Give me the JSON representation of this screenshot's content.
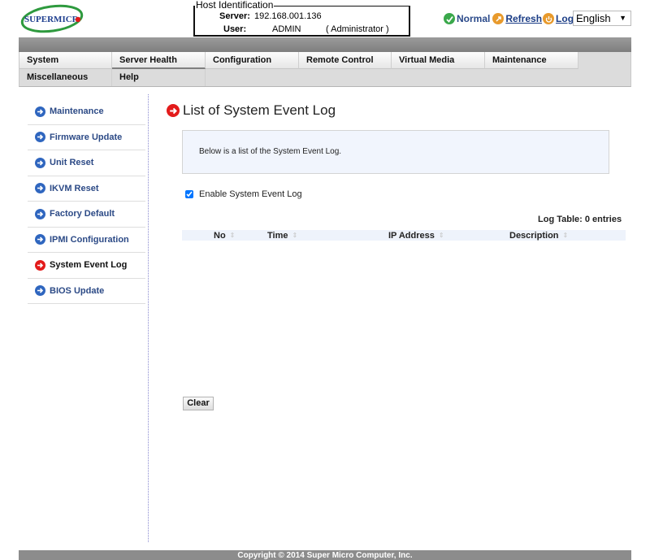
{
  "header": {
    "logo_text": "SUPERMICR",
    "host_identification": {
      "legend": "Host Identification",
      "server_label": "Server:",
      "server_value": "192.168.001.136",
      "user_label": "User:",
      "user_value": "ADMIN",
      "user_role": "( Administrator )"
    },
    "status": {
      "normal_label": "Normal",
      "refresh_label": "Refresh",
      "logout_label": "Logout",
      "language_selected": "English"
    },
    "colors": {
      "normal_icon": "#3aa84b",
      "refresh_icon": "#e89a2c",
      "logout_icon": "#e89a2c"
    }
  },
  "nav": {
    "top_row": [
      {
        "label": "System"
      },
      {
        "label": "Server Health"
      },
      {
        "label": "Configuration"
      },
      {
        "label": "Remote Control"
      },
      {
        "label": "Virtual Media"
      },
      {
        "label": "Maintenance"
      }
    ],
    "bottom_row": [
      {
        "label": "Miscellaneous"
      },
      {
        "label": "Help"
      }
    ]
  },
  "sidebar": {
    "items": [
      {
        "label": "Maintenance",
        "icon": "arrow-right-circle-icon"
      },
      {
        "label": "Firmware Update",
        "icon": "arrow-right-circle-icon"
      },
      {
        "label": "Unit Reset",
        "icon": "arrow-right-circle-icon"
      },
      {
        "label": "IKVM Reset",
        "icon": "arrow-right-circle-icon"
      },
      {
        "label": "Factory Default",
        "icon": "arrow-right-circle-icon"
      },
      {
        "label": "IPMI Configuration",
        "icon": "arrow-right-circle-icon"
      },
      {
        "label": "System Event Log",
        "icon": "arrow-right-circle-icon",
        "active": true
      },
      {
        "label": "BIOS Update",
        "icon": "arrow-right-circle-icon"
      }
    ],
    "colors": {
      "icon": "#2f66bf",
      "active_icon": "#e31b1b"
    }
  },
  "main": {
    "title": "List of System Event Log",
    "info_text": "Below is a list of the System Event Log.",
    "enable_label": "Enable System Event Log",
    "enable_checked": true,
    "log_count": "Log Table: 0 entries",
    "table": {
      "columns": [
        "No",
        "Time",
        "IP Address",
        "Description"
      ],
      "rows": []
    },
    "clear_label": "Clear"
  },
  "footer": {
    "copyright": "Copyright © 2014 Super Micro Computer, Inc."
  }
}
